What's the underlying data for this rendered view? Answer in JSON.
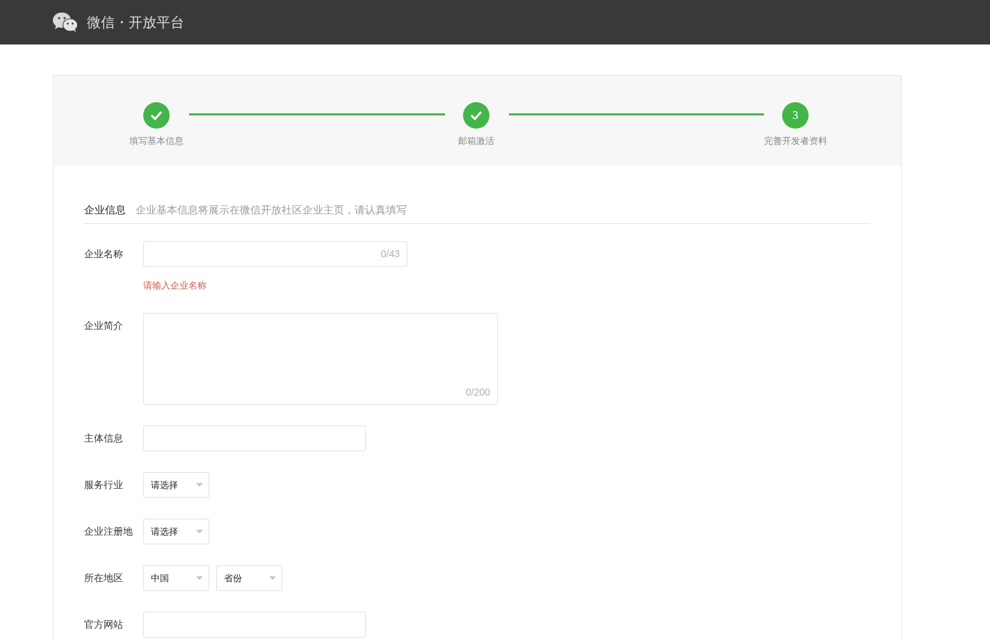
{
  "header": {
    "title": "微信・开放平台"
  },
  "steps": [
    {
      "label": "填写基本信息",
      "done": true
    },
    {
      "label": "邮箱激活",
      "done": true
    },
    {
      "label": "完善开发者资料",
      "done": false,
      "number": "3"
    }
  ],
  "section": {
    "title": "企业信息",
    "hint": "企业基本信息将展示在微信开放社区企业主页，请认真填写"
  },
  "fields": [
    {
      "label": "企业名称",
      "kind": "text",
      "counter": "0/43",
      "error": "请输入企业名称"
    },
    {
      "label": "企业简介",
      "kind": "textarea",
      "counter": "0/200"
    },
    {
      "label": "主体信息",
      "kind": "text"
    },
    {
      "label": "服务行业",
      "kind": "select",
      "selects": [
        {
          "value": "请选择"
        }
      ]
    },
    {
      "label": "企业注册地",
      "kind": "select",
      "selects": [
        {
          "value": "请选择"
        }
      ]
    },
    {
      "label": "所在地区",
      "kind": "select",
      "selects": [
        {
          "value": "中国"
        },
        {
          "value": "省份"
        }
      ]
    },
    {
      "label": "官方网站",
      "kind": "text"
    }
  ]
}
